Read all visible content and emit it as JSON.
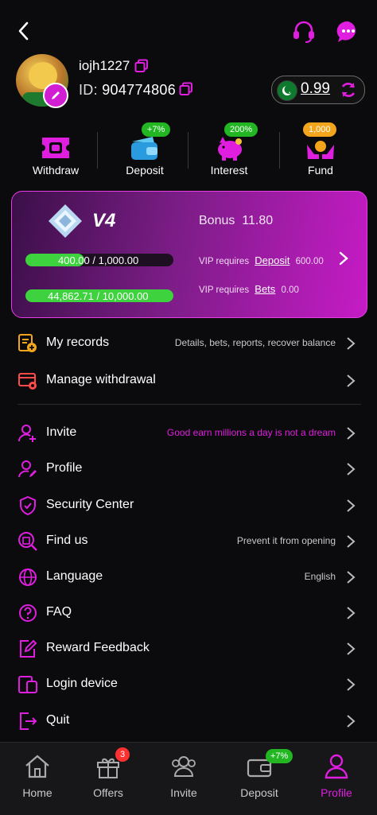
{
  "header": {
    "back_icon": "chevron-left-icon",
    "support_icon": "headset-icon",
    "chat_icon": "chat-bubble-icon"
  },
  "user": {
    "name": "iojh1227",
    "id_label": "ID:",
    "id_value": "904774806",
    "balance": "0.99",
    "flag_icon": "pakistan-flag-icon"
  },
  "quick_actions": [
    {
      "label": "Withdraw",
      "badge": "",
      "icon": "ticket-icon"
    },
    {
      "label": "Deposit",
      "badge": "+7%",
      "icon": "wallet-icon"
    },
    {
      "label": "Interest",
      "badge": "200%",
      "icon": "piggy-bank-icon"
    },
    {
      "label": "Fund",
      "badge": "1,000",
      "icon": "hands-coin-icon"
    }
  ],
  "vip": {
    "level": "V4",
    "bonus_label": "Bonus",
    "bonus_value": "11.80",
    "deposit_current": "400.00",
    "deposit_target": "/ 1,000.00",
    "deposit_progress": 0.4,
    "bets_current": "44,862.71",
    "bets_target": "/ 10,000.00",
    "bets_progress": 1.0,
    "req_label": "VIP requires",
    "deposit_link": "Deposit",
    "deposit_req_value": "600.00",
    "bets_link": "Bets",
    "bets_req_value": "0.00"
  },
  "menu": {
    "group1": [
      {
        "label": "My records",
        "sub": "Details, bets, reports, recover balance",
        "icon": "records-icon"
      },
      {
        "label": "Manage withdrawal",
        "sub": "",
        "icon": "card-settings-icon"
      }
    ],
    "group2": [
      {
        "label": "Invite",
        "sub": "Good earn millions a day is not a dream",
        "icon": "invite-user-icon"
      },
      {
        "label": "Profile",
        "sub": "",
        "icon": "user-edit-icon"
      },
      {
        "label": "Security Center",
        "sub": "",
        "icon": "shield-check-icon"
      },
      {
        "label": "Find us",
        "sub": "Prevent it from opening",
        "icon": "search-building-icon"
      },
      {
        "label": "Language",
        "sub": "English",
        "icon": "globe-icon"
      },
      {
        "label": "FAQ",
        "sub": "",
        "icon": "question-icon"
      },
      {
        "label": "Reward Feedback",
        "sub": "",
        "icon": "feedback-edit-icon"
      },
      {
        "label": "Login device",
        "sub": "",
        "icon": "devices-icon"
      },
      {
        "label": "Quit",
        "sub": "",
        "icon": "logout-icon"
      }
    ],
    "colors": {
      "accent": "#e01ee0",
      "subtext_accent": "#e01ee0"
    }
  },
  "tabs": [
    {
      "label": "Home",
      "badge": "",
      "icon": "home-icon"
    },
    {
      "label": "Offers",
      "badge": "3",
      "icon": "gift-icon"
    },
    {
      "label": "Invite",
      "badge": "",
      "icon": "group-icon"
    },
    {
      "label": "Deposit",
      "badge": "+7%",
      "icon": "wallet-icon"
    },
    {
      "label": "Profile",
      "badge": "",
      "icon": "user-icon",
      "active": true
    }
  ]
}
